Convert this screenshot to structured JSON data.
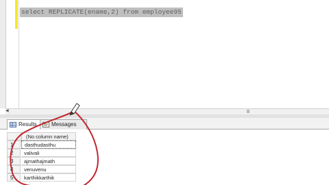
{
  "editor": {
    "query": "select REPLICATE(ename,2) from employee95"
  },
  "tabs": [
    {
      "label": "Results",
      "icon": "grid-icon"
    },
    {
      "label": "Messages",
      "icon": "message-icon"
    }
  ],
  "grid": {
    "column_header": "(No column name)",
    "rows": [
      {
        "num": "1",
        "value": "dasthudasthu"
      },
      {
        "num": "2",
        "value": "valivali"
      },
      {
        "num": "3",
        "value": "ajmathajmath"
      },
      {
        "num": "4",
        "value": "venuvenu"
      },
      {
        "num": "5",
        "value": "karthikkarthik"
      }
    ]
  },
  "colors": {
    "query_highlight": "#bfbfbf",
    "change_bar": "#f4e82a",
    "annotation": "#c0262d"
  }
}
